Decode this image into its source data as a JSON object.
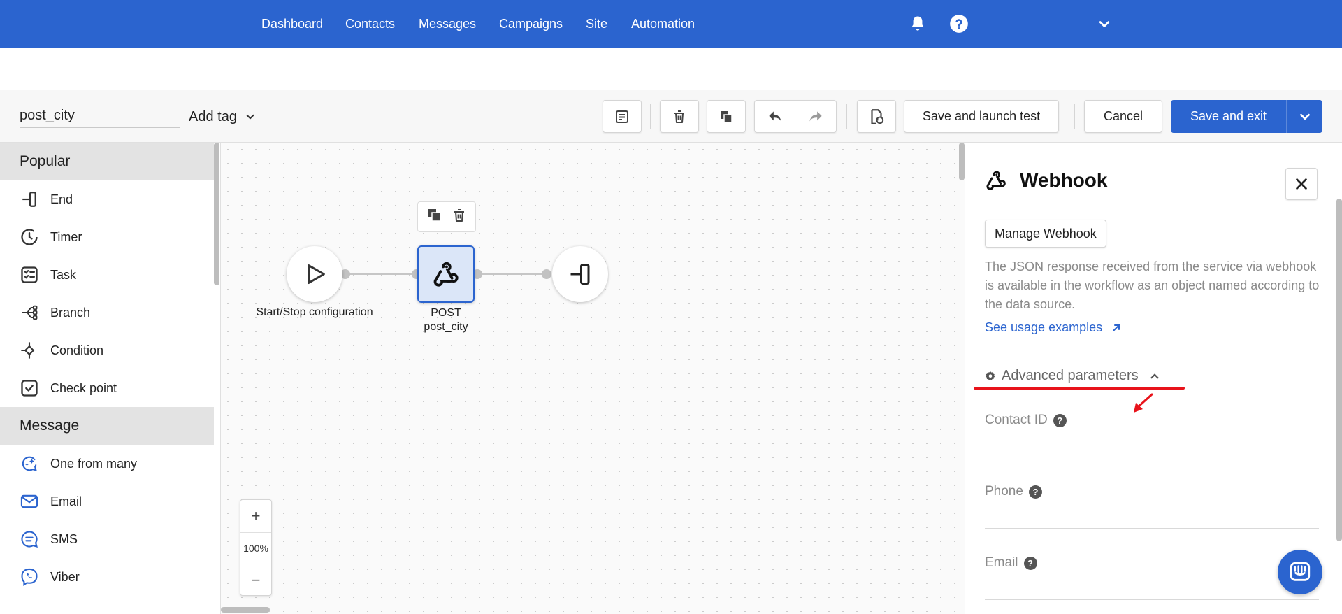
{
  "nav": {
    "items": [
      "Dashboard",
      "Contacts",
      "Messages",
      "Campaigns",
      "Site",
      "Automation"
    ],
    "icons": [
      "bell-icon",
      "help-circle-icon",
      "chevron-down-icon"
    ],
    "color": "#2b64cf"
  },
  "toolbar": {
    "workflow_name": "post_city",
    "add_tag_label": "Add tag",
    "icons": [
      "notes-icon",
      "trash-icon",
      "duplicate-icon",
      "undo-icon",
      "redo-icon",
      "restore-version-icon"
    ],
    "save_test_label": "Save and launch test",
    "cancel_label": "Cancel",
    "save_exit_label": "Save and exit"
  },
  "sidebar": {
    "groups": [
      {
        "title": "Popular",
        "items": [
          {
            "label": "End",
            "icon": "end-icon"
          },
          {
            "label": "Timer",
            "icon": "timer-icon"
          },
          {
            "label": "Task",
            "icon": "task-icon"
          },
          {
            "label": "Branch",
            "icon": "branch-icon"
          },
          {
            "label": "Condition",
            "icon": "condition-icon"
          },
          {
            "label": "Check point",
            "icon": "check-point-icon"
          }
        ]
      },
      {
        "title": "Message",
        "items": [
          {
            "label": "One from many",
            "icon": "sparkle-chat-icon"
          },
          {
            "label": "Email",
            "icon": "email-icon"
          },
          {
            "label": "SMS",
            "icon": "sms-icon"
          },
          {
            "label": "Viber",
            "icon": "viber-icon"
          }
        ]
      }
    ]
  },
  "canvas": {
    "nodes": [
      {
        "label": "Start/Stop configuration",
        "icon": "play-icon"
      },
      {
        "label_line1": "POST",
        "label_line2": "post_city",
        "icon": "webhook-icon"
      },
      {
        "icon": "end-icon"
      }
    ],
    "zoom": {
      "in": "+",
      "level": "100%",
      "out": "−"
    }
  },
  "panel": {
    "title": "Webhook",
    "manage_label": "Manage Webhook",
    "description": "The JSON response received from the service via webhook is available in the workflow as an object named according to the data source.",
    "usage_link": "See usage examples",
    "advanced_label": "Advanced parameters",
    "fields": [
      {
        "label": "Contact ID"
      },
      {
        "label": "Phone"
      },
      {
        "label": "Email"
      }
    ],
    "highlight_color": "#e8131b"
  }
}
